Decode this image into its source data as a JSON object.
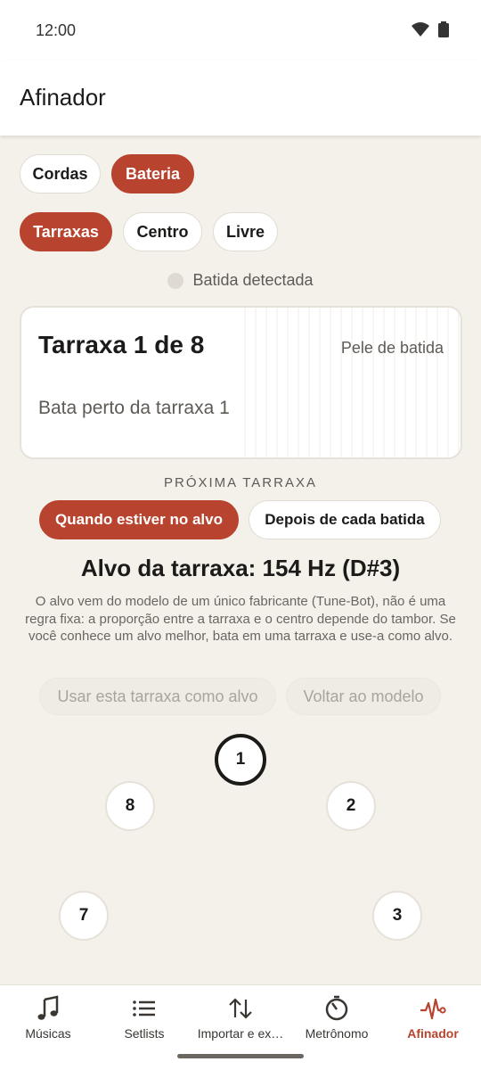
{
  "status": {
    "time": "12:00",
    "icons": [
      "wifi-icon",
      "battery-icon"
    ]
  },
  "app": {
    "title": "Afinador"
  },
  "instrument_tabs": [
    {
      "label": "Cordas",
      "active": false
    },
    {
      "label": "Bateria",
      "active": true
    }
  ],
  "mode_tabs": [
    {
      "label": "Tarraxas",
      "active": true
    },
    {
      "label": "Centro",
      "active": false
    },
    {
      "label": "Livre",
      "active": false
    }
  ],
  "detection": {
    "label": "Batida detectada"
  },
  "card": {
    "title": "Tarraxa 1 de 8",
    "head": "Pele de batida",
    "hint": "Bata perto da tarraxa 1"
  },
  "next_lug": {
    "label": "PRÓXIMA TARRAXA",
    "options": [
      {
        "label": "Quando estiver no alvo",
        "active": true
      },
      {
        "label": "Depois de cada batida",
        "active": false
      }
    ]
  },
  "target": {
    "text": "Alvo da tarraxa: 154 Hz (D#3)",
    "explanation": "O alvo vem do modelo de um único fabricante (Tune-Bot), não é uma regra fixa: a proporção entre a tarraxa e o centro depende do tambor. Se você conhece um alvo melhor, bata em uma tarraxa e use-a como alvo."
  },
  "actions": {
    "use_lug": "Usar esta tarraxa como alvo",
    "reset": "Voltar ao modelo"
  },
  "lugs": {
    "active": "1",
    "items": [
      "1",
      "2",
      "3",
      "7",
      "8"
    ]
  },
  "nav": {
    "items": [
      {
        "label": "Músicas",
        "icon": "music-note-icon",
        "active": false
      },
      {
        "label": "Setlists",
        "icon": "list-icon",
        "active": false
      },
      {
        "label": "Importar e ex…",
        "icon": "import-export-icon",
        "active": false
      },
      {
        "label": "Metrônomo",
        "icon": "metronome-icon",
        "active": false
      },
      {
        "label": "Afinador",
        "icon": "tuner-icon",
        "active": true
      }
    ]
  },
  "colors": {
    "accent": "#b8432e",
    "background": "#f4f1ea",
    "surface": "#ffffff"
  }
}
